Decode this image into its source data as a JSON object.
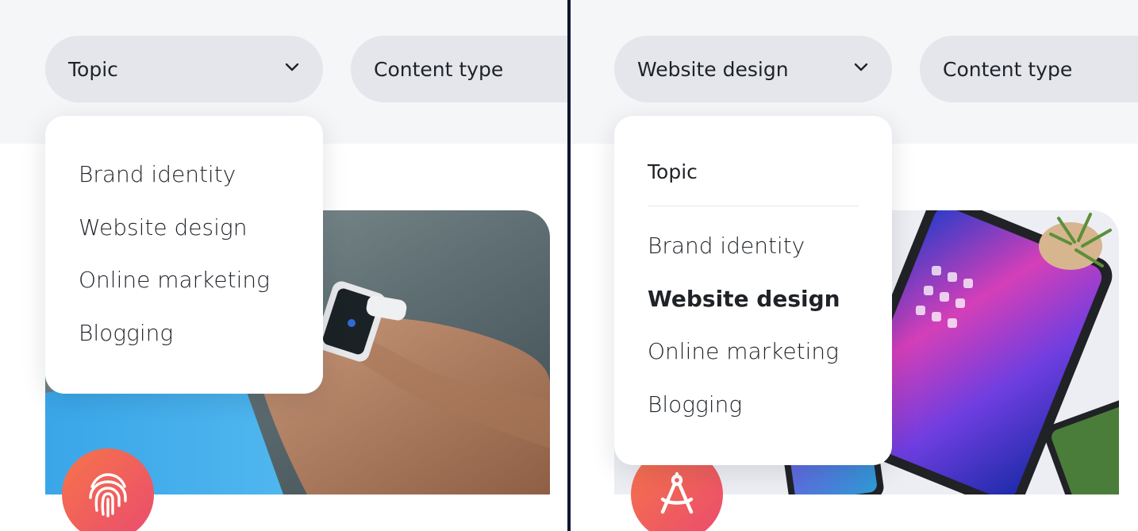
{
  "left_panel": {
    "topic_filter": {
      "label": "Topic",
      "icon": "chevron-down-icon"
    },
    "content_type_filter": {
      "label": "Content type"
    },
    "dropdown": {
      "items": [
        "Brand identity",
        "Website design",
        "Online marketing",
        "Blogging"
      ]
    },
    "card": {
      "badge_icon": "fingerprint-icon"
    }
  },
  "right_panel": {
    "topic_filter": {
      "label": "Website design",
      "icon": "chevron-down-icon"
    },
    "content_type_filter": {
      "label": "Content type"
    },
    "dropdown": {
      "heading": "Topic",
      "items": [
        "Brand identity",
        "Website design",
        "Online marketing",
        "Blogging"
      ],
      "selected": "Website design"
    },
    "card": {
      "badge_icon": "drafting-compass-icon"
    }
  },
  "colors": {
    "filter_bar_bg": "#f5f6f8",
    "pill_bg": "#e4e6eb",
    "badge_gradient_start": "#f6744a",
    "badge_gradient_end": "#ea4b6e",
    "divider": "#0f1631"
  }
}
